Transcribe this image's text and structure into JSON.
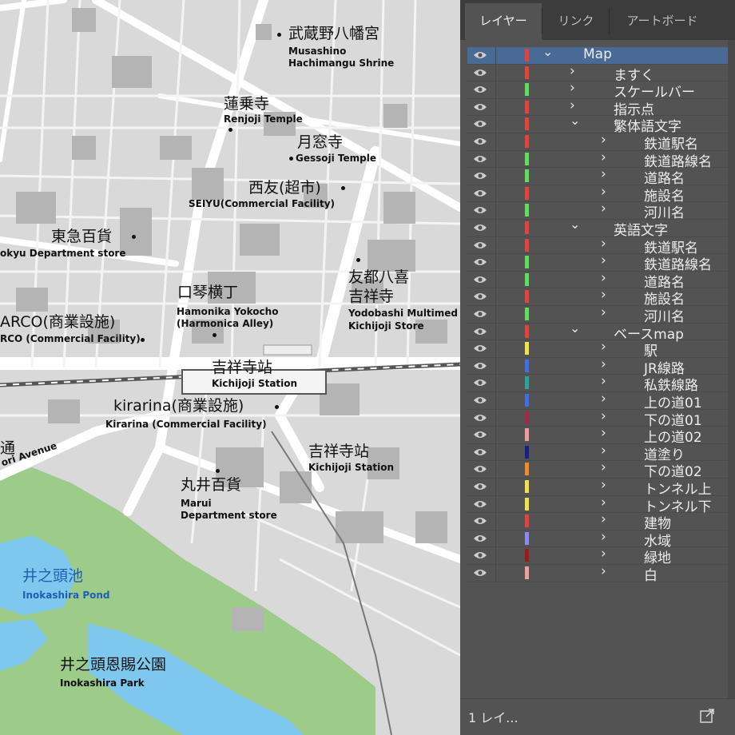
{
  "map": {
    "labels": [
      {
        "id": "musashino-ja",
        "text": "武蔵野八幡宮",
        "kind": "ja"
      },
      {
        "id": "musashino-en1",
        "text": "Musashino",
        "kind": "en"
      },
      {
        "id": "musashino-en2",
        "text": "Hachimangu Shrine",
        "kind": "en"
      },
      {
        "id": "renjoji-ja",
        "text": "蓮乗寺",
        "kind": "ja"
      },
      {
        "id": "renjoji-en",
        "text": "Renjoji Temple",
        "kind": "en"
      },
      {
        "id": "gessoji-ja",
        "text": "月窓寺",
        "kind": "ja"
      },
      {
        "id": "gessoji-en",
        "text": "Gessoji Temple",
        "kind": "en"
      },
      {
        "id": "seiyu-ja",
        "text": "西友(超市)",
        "kind": "ja"
      },
      {
        "id": "seiyu-en",
        "text": "SEIYU(Commercial Facility)",
        "kind": "en"
      },
      {
        "id": "tokyu-ja",
        "text": "東急百貨",
        "kind": "ja"
      },
      {
        "id": "tokyu-en",
        "text": "okyu Department store",
        "kind": "en"
      },
      {
        "id": "harmonica-ja",
        "text": "口琴横丁",
        "kind": "ja"
      },
      {
        "id": "harmonica-en1",
        "text": "Hamonika Yokocho",
        "kind": "en"
      },
      {
        "id": "harmonica-en2",
        "text": "(Harmonica Alley)",
        "kind": "en"
      },
      {
        "id": "yodobashi-ja1",
        "text": "友都八喜",
        "kind": "ja"
      },
      {
        "id": "yodobashi-ja2",
        "text": "吉祥寺",
        "kind": "ja"
      },
      {
        "id": "yodobashi-en1",
        "text": "Yodobashi Multimed",
        "kind": "en"
      },
      {
        "id": "yodobashi-en2",
        "text": "Kichijoji Store",
        "kind": "en"
      },
      {
        "id": "parco-ja",
        "text": "ARCO(商業設施)",
        "kind": "ja"
      },
      {
        "id": "parco-en",
        "text": "RCO (Commercial Facility)",
        "kind": "en"
      },
      {
        "id": "station-ja",
        "text": "吉祥寺站",
        "kind": "ja"
      },
      {
        "id": "station-en",
        "text": "Kichijoji Station",
        "kind": "en"
      },
      {
        "id": "kirarina-ja",
        "text": "kirarina(商業設施)",
        "kind": "ja"
      },
      {
        "id": "kirarina-en",
        "text": "Kirarina (Commercial Facility)",
        "kind": "en"
      },
      {
        "id": "station2-ja",
        "text": "吉祥寺站",
        "kind": "ja"
      },
      {
        "id": "station2-en",
        "text": "Kichijoji Station",
        "kind": "en"
      },
      {
        "id": "avenue-ja",
        "text": "通",
        "kind": "ja"
      },
      {
        "id": "avenue-en",
        "text": "ori Avenue",
        "kind": "en"
      },
      {
        "id": "marui-ja",
        "text": "丸井百貨",
        "kind": "ja"
      },
      {
        "id": "marui-en1",
        "text": "Marui",
        "kind": "en"
      },
      {
        "id": "marui-en2",
        "text": "Department store",
        "kind": "en"
      },
      {
        "id": "pond-ja",
        "text": "井之頭池",
        "kind": "water-ja"
      },
      {
        "id": "pond-en",
        "text": "Inokashira Pond",
        "kind": "water-en"
      },
      {
        "id": "park-ja",
        "text": "井之頭恩賜公園",
        "kind": "ja"
      },
      {
        "id": "park-en",
        "text": "Inokashira Park",
        "kind": "en"
      }
    ]
  },
  "panel": {
    "tabs": [
      {
        "label": "レイヤー",
        "active": true
      },
      {
        "label": "リンク",
        "active": false
      },
      {
        "label": "アートボード",
        "active": false
      }
    ],
    "layers": [
      {
        "name": "Map",
        "depth": 0,
        "expanded": true,
        "color": "#e8413c"
      },
      {
        "name": "ますく",
        "depth": 1,
        "expanded": false,
        "color": "#e8413c"
      },
      {
        "name": "スケールバー",
        "depth": 1,
        "expanded": false,
        "color": "#5fe05a"
      },
      {
        "name": "指示点",
        "depth": 1,
        "expanded": false,
        "color": "#e8413c"
      },
      {
        "name": "繁体語文字",
        "depth": 1,
        "expanded": true,
        "color": "#e8413c"
      },
      {
        "name": "鉄道駅名",
        "depth": 2,
        "expanded": false,
        "color": "#e8413c"
      },
      {
        "name": "鉄道路線名",
        "depth": 2,
        "expanded": false,
        "color": "#5fe05a"
      },
      {
        "name": "道路名",
        "depth": 2,
        "expanded": false,
        "color": "#5fe05a"
      },
      {
        "name": "施設名",
        "depth": 2,
        "expanded": false,
        "color": "#e8413c"
      },
      {
        "name": "河川名",
        "depth": 2,
        "expanded": false,
        "color": "#5fe05a"
      },
      {
        "name": "英語文字",
        "depth": 1,
        "expanded": true,
        "color": "#e8413c"
      },
      {
        "name": "鉄道駅名",
        "depth": 2,
        "expanded": false,
        "color": "#e8413c"
      },
      {
        "name": "鉄道路線名",
        "depth": 2,
        "expanded": false,
        "color": "#5fe05a"
      },
      {
        "name": "道路名",
        "depth": 2,
        "expanded": false,
        "color": "#5fe05a"
      },
      {
        "name": "施設名",
        "depth": 2,
        "expanded": false,
        "color": "#e8413c"
      },
      {
        "name": "河川名",
        "depth": 2,
        "expanded": false,
        "color": "#5fe05a"
      },
      {
        "name": "ベースmap",
        "depth": 1,
        "expanded": true,
        "color": "#e8413c"
      },
      {
        "name": "駅",
        "depth": 2,
        "expanded": false,
        "color": "#f2e14b"
      },
      {
        "name": "JR線路",
        "depth": 2,
        "expanded": false,
        "color": "#3f6ff0"
      },
      {
        "name": "私鉄線路",
        "depth": 2,
        "expanded": false,
        "color": "#2aa39a"
      },
      {
        "name": "上の道01",
        "depth": 2,
        "expanded": false,
        "color": "#3f6ff0"
      },
      {
        "name": "下の道01",
        "depth": 2,
        "expanded": false,
        "color": "#a3284a"
      },
      {
        "name": "上の道02",
        "depth": 2,
        "expanded": false,
        "color": "#f09aa0"
      },
      {
        "name": "道塗り",
        "depth": 2,
        "expanded": false,
        "color": "#14208a"
      },
      {
        "name": "下の道02",
        "depth": 2,
        "expanded": false,
        "color": "#f08a2a"
      },
      {
        "name": "トンネル上",
        "depth": 2,
        "expanded": false,
        "color": "#f2e14b"
      },
      {
        "name": "トンネル下",
        "depth": 2,
        "expanded": false,
        "color": "#f2e14b"
      },
      {
        "name": "建物",
        "depth": 2,
        "expanded": false,
        "color": "#e8413c"
      },
      {
        "name": "水域",
        "depth": 2,
        "expanded": false,
        "color": "#8a8af0"
      },
      {
        "name": "緑地",
        "depth": 2,
        "expanded": false,
        "color": "#a01a14"
      },
      {
        "name": "白",
        "depth": 2,
        "expanded": false,
        "color": "#f0a0a0"
      }
    ],
    "footer": {
      "label": "1 レイ..."
    }
  },
  "colors": {
    "selection": "#4a6a96",
    "panel_bg": "#535353",
    "water": "#1e5fb3",
    "park": "#9ccb8a"
  }
}
